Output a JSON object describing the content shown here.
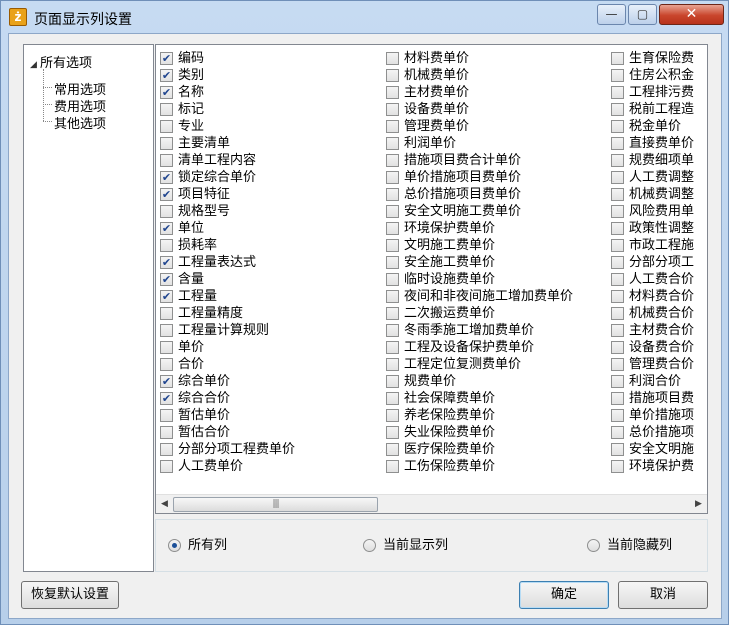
{
  "window": {
    "title": "页面显示列设置",
    "app_icon_glyph": "ż",
    "minimize": "—",
    "maximize": "▢",
    "close": "✕"
  },
  "tree": {
    "root": "所有选项",
    "children": [
      "常用选项",
      "费用选项",
      "其他选项"
    ]
  },
  "columns": [
    [
      {
        "label": "编码",
        "checked": true
      },
      {
        "label": "类别",
        "checked": true
      },
      {
        "label": "名称",
        "checked": true
      },
      {
        "label": "标记",
        "checked": false
      },
      {
        "label": "专业",
        "checked": false
      },
      {
        "label": "主要清单",
        "checked": false
      },
      {
        "label": "清单工程内容",
        "checked": false
      },
      {
        "label": "锁定综合单价",
        "checked": true
      },
      {
        "label": "项目特征",
        "checked": true
      },
      {
        "label": "规格型号",
        "checked": false
      },
      {
        "label": "单位",
        "checked": true
      },
      {
        "label": "损耗率",
        "checked": false
      },
      {
        "label": "工程量表达式",
        "checked": true
      },
      {
        "label": "含量",
        "checked": true
      },
      {
        "label": "工程量",
        "checked": true
      },
      {
        "label": "工程量精度",
        "checked": false
      },
      {
        "label": "工程量计算规则",
        "checked": false
      },
      {
        "label": "单价",
        "checked": false
      },
      {
        "label": "合价",
        "checked": false
      },
      {
        "label": "综合单价",
        "checked": true
      },
      {
        "label": "综合合价",
        "checked": true
      },
      {
        "label": "暂估单价",
        "checked": false
      },
      {
        "label": "暂估合价",
        "checked": false
      },
      {
        "label": "分部分项工程费单价",
        "checked": false
      },
      {
        "label": "人工费单价",
        "checked": false
      }
    ],
    [
      {
        "label": "材料费单价",
        "checked": false
      },
      {
        "label": "机械费单价",
        "checked": false
      },
      {
        "label": "主材费单价",
        "checked": false
      },
      {
        "label": "设备费单价",
        "checked": false
      },
      {
        "label": "管理费单价",
        "checked": false
      },
      {
        "label": "利润单价",
        "checked": false
      },
      {
        "label": "措施项目费合计单价",
        "checked": false
      },
      {
        "label": "单价措施项目费单价",
        "checked": false
      },
      {
        "label": "总价措施项目费单价",
        "checked": false
      },
      {
        "label": "安全文明施工费单价",
        "checked": false
      },
      {
        "label": "环境保护费单价",
        "checked": false
      },
      {
        "label": "文明施工费单价",
        "checked": false
      },
      {
        "label": "安全施工费单价",
        "checked": false
      },
      {
        "label": "临时设施费单价",
        "checked": false
      },
      {
        "label": "夜间和非夜间施工增加费单价",
        "checked": false
      },
      {
        "label": "二次搬运费单价",
        "checked": false
      },
      {
        "label": "冬雨季施工增加费单价",
        "checked": false
      },
      {
        "label": "工程及设备保护费单价",
        "checked": false
      },
      {
        "label": "工程定位复测费单价",
        "checked": false
      },
      {
        "label": "规费单价",
        "checked": false
      },
      {
        "label": "社会保障费单价",
        "checked": false
      },
      {
        "label": "养老保险费单价",
        "checked": false
      },
      {
        "label": "失业保险费单价",
        "checked": false
      },
      {
        "label": "医疗保险费单价",
        "checked": false
      },
      {
        "label": "工伤保险费单价",
        "checked": false
      }
    ],
    [
      {
        "label": "生育保险费",
        "checked": false
      },
      {
        "label": "住房公积金",
        "checked": false
      },
      {
        "label": "工程排污费",
        "checked": false
      },
      {
        "label": "税前工程造",
        "checked": false
      },
      {
        "label": "税金单价",
        "checked": false
      },
      {
        "label": "直接费单价",
        "checked": false
      },
      {
        "label": "规费细项单",
        "checked": false
      },
      {
        "label": "人工费调整",
        "checked": false
      },
      {
        "label": "机械费调整",
        "checked": false
      },
      {
        "label": "风险费用单",
        "checked": false
      },
      {
        "label": "政策性调整",
        "checked": false
      },
      {
        "label": "市政工程施",
        "checked": false
      },
      {
        "label": "分部分项工",
        "checked": false
      },
      {
        "label": "人工费合价",
        "checked": false
      },
      {
        "label": "材料费合价",
        "checked": false
      },
      {
        "label": "机械费合价",
        "checked": false
      },
      {
        "label": "主材费合价",
        "checked": false
      },
      {
        "label": "设备费合价",
        "checked": false
      },
      {
        "label": "管理费合价",
        "checked": false
      },
      {
        "label": "利润合价",
        "checked": false
      },
      {
        "label": "措施项目费",
        "checked": false
      },
      {
        "label": "单价措施项",
        "checked": false
      },
      {
        "label": "总价措施项",
        "checked": false
      },
      {
        "label": "安全文明施",
        "checked": false
      },
      {
        "label": "环境保护费",
        "checked": false
      }
    ]
  ],
  "scrollbar": {
    "left_arrow": "◀",
    "right_arrow": "▶",
    "grip": "|||"
  },
  "radio": {
    "options": [
      "所有列",
      "当前显示列",
      "当前隐藏列"
    ],
    "selected": 0
  },
  "buttons": {
    "restore": "恢复默认设置",
    "ok": "确定",
    "cancel": "取消"
  }
}
